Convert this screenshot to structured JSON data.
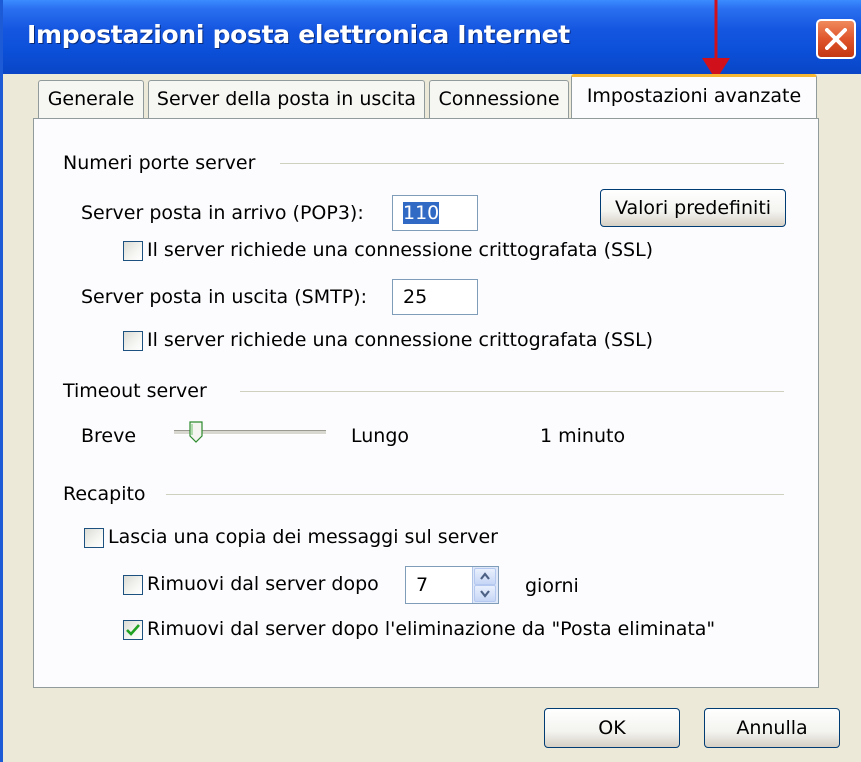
{
  "window": {
    "title": "Impostazioni posta elettronica Internet"
  },
  "tabs": [
    {
      "label": "Generale"
    },
    {
      "label": "Server della posta in uscita"
    },
    {
      "label": "Connessione"
    },
    {
      "label": "Impostazioni avanzate"
    }
  ],
  "ports_group": {
    "title": "Numeri porte server",
    "incoming_label": "Server posta in arrivo (POP3):",
    "incoming_value": "110",
    "incoming_ssl_label": "Il server richiede una connessione crittografata (SSL)",
    "incoming_ssl_checked": false,
    "outgoing_label": "Server posta in uscita (SMTP):",
    "outgoing_value": "25",
    "outgoing_ssl_label": "Il server richiede una connessione crittografata (SSL)",
    "outgoing_ssl_checked": false,
    "defaults_button": "Valori predefiniti"
  },
  "timeout_group": {
    "title": "Timeout server",
    "short_label": "Breve",
    "long_label": "Lungo",
    "value_text": "1 minuto",
    "slider_level": 0.1
  },
  "delivery_group": {
    "title": "Recapito",
    "leave_copy_label": "Lascia una copia dei messaggi sul server",
    "leave_copy_checked": false,
    "remove_after_label": "Rimuovi dal server dopo",
    "remove_after_checked": false,
    "days_value": "7",
    "days_unit": "giorni",
    "remove_deleted_label": "Rimuovi dal server dopo l'eliminazione da \"Posta eliminata\"",
    "remove_deleted_checked": true
  },
  "buttons": {
    "ok": "OK",
    "cancel": "Annulla"
  },
  "colors": {
    "titlebar": "#0b4fd8",
    "active_tab_accent": "#f8b732",
    "arrow": "#d0111b",
    "selection": "#316ac5",
    "check": "#21a121"
  }
}
